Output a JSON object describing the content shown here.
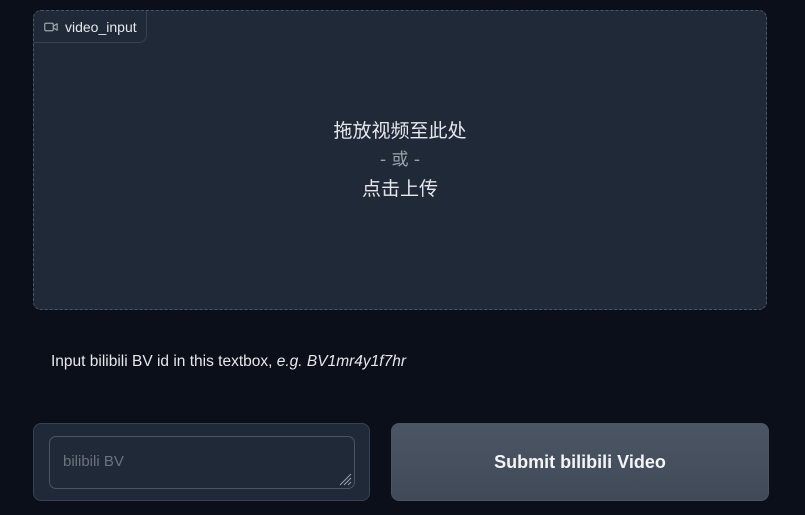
{
  "video_input": {
    "label": "video_input",
    "icon": "video-camera-icon",
    "drop_text": "拖放视频至此处",
    "or_text": "- 或 -",
    "click_text": "点击上传"
  },
  "hint": {
    "prefix": "Input bilibili BV id in this textbox, ",
    "example_label": "e.g.",
    "example_value": "BV1mr4y1f7hr"
  },
  "bv_input": {
    "value": "",
    "placeholder": "bilibili BV"
  },
  "submit": {
    "label": "Submit bilibili Video"
  },
  "colors": {
    "background": "#0b0f19",
    "panel": "#1f2937",
    "button": "#4b5563"
  }
}
